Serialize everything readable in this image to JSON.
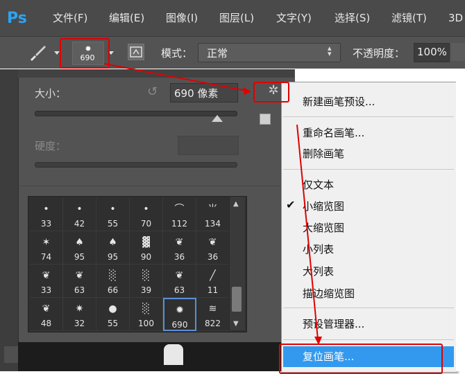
{
  "app": {
    "logo_text": "Ps"
  },
  "menu": {
    "items": [
      "文件(F)",
      "编辑(E)",
      "图像(I)",
      "图层(L)",
      "文字(Y)",
      "选择(S)",
      "滤镜(T)",
      "3D"
    ]
  },
  "options_bar": {
    "brush_preset_size": "690",
    "mode_label": "模式：",
    "mode_value": "正常",
    "opacity_label": "不透明度：",
    "opacity_value": "100%"
  },
  "brush_panel": {
    "size_label": "大小：",
    "size_value": "690 像素",
    "size_fraction": 0.9,
    "hardness_label": "硬度：",
    "presets": [
      {
        "size": "33",
        "glyph": "•"
      },
      {
        "size": "42",
        "glyph": "•"
      },
      {
        "size": "55",
        "glyph": "•"
      },
      {
        "size": "70",
        "glyph": "•"
      },
      {
        "size": "112",
        "glyph": "⌒"
      },
      {
        "size": "134",
        "glyph": "⺌"
      },
      {
        "size": "74",
        "glyph": "✶"
      },
      {
        "size": "95",
        "glyph": "♠"
      },
      {
        "size": "95",
        "glyph": "♠"
      },
      {
        "size": "90",
        "glyph": "▓"
      },
      {
        "size": "36",
        "glyph": "❦"
      },
      {
        "size": "36",
        "glyph": "❦"
      },
      {
        "size": "33",
        "glyph": "❦"
      },
      {
        "size": "63",
        "glyph": "❦"
      },
      {
        "size": "66",
        "glyph": "░"
      },
      {
        "size": "39",
        "glyph": "░"
      },
      {
        "size": "63",
        "glyph": "❦"
      },
      {
        "size": "11",
        "glyph": "╱"
      },
      {
        "size": "48",
        "glyph": "❦"
      },
      {
        "size": "32",
        "glyph": "✷"
      },
      {
        "size": "55",
        "glyph": "●"
      },
      {
        "size": "100",
        "glyph": "░"
      },
      {
        "size": "690",
        "glyph": "✹"
      },
      {
        "size": "822",
        "glyph": "≋"
      }
    ],
    "selected_preset_index": 22
  },
  "context_menu": {
    "new_preset": "新建画笔预设...",
    "rename": "重命名画笔...",
    "delete": "删除画笔",
    "text_only": "仅文本",
    "small_thumbnail": "小缩览图",
    "large_thumbnail": "大缩览图",
    "small_list": "小列表",
    "large_list": "大列表",
    "stroke_thumbnail": "描边缩览图",
    "preset_manager": "预设管理器...",
    "reset_brushes": "复位画笔...",
    "checked_item": "小缩览图"
  },
  "colors": {
    "annotation_red": "#e00000",
    "highlight_blue": "#3399ee",
    "ps_blue": "#2fa3f0"
  }
}
